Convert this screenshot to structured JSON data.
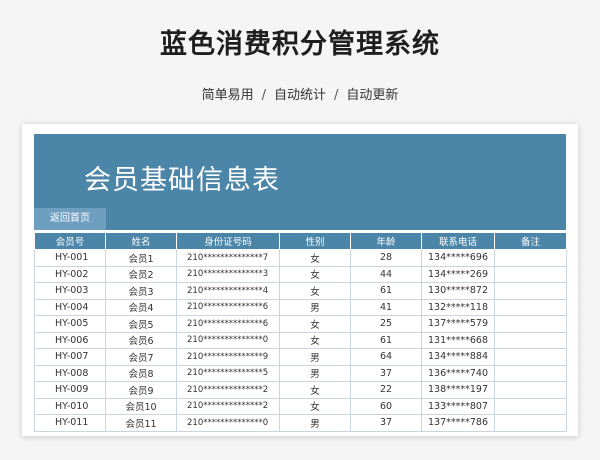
{
  "page": {
    "title": "蓝色消费积分管理系统",
    "subtitle": [
      "简单易用",
      "自动统计",
      "自动更新"
    ],
    "separator": "/"
  },
  "sheet": {
    "banner_title": "会员基础信息表",
    "back_button": "返回首页",
    "colors": {
      "header": "#4b85a8",
      "button": "#6f9fc0"
    },
    "columns": [
      "会员号",
      "姓名",
      "身份证号码",
      "性别",
      "年龄",
      "联系电话",
      "备注"
    ],
    "rows": [
      [
        "HY-001",
        "会员1",
        "210**************7",
        "女",
        "28",
        "134*****696",
        ""
      ],
      [
        "HY-002",
        "会员2",
        "210**************3",
        "女",
        "44",
        "134*****269",
        ""
      ],
      [
        "HY-003",
        "会员3",
        "210**************4",
        "女",
        "61",
        "130*****872",
        ""
      ],
      [
        "HY-004",
        "会员4",
        "210**************6",
        "男",
        "41",
        "132*****118",
        ""
      ],
      [
        "HY-005",
        "会员5",
        "210**************6",
        "女",
        "25",
        "137*****579",
        ""
      ],
      [
        "HY-006",
        "会员6",
        "210**************0",
        "女",
        "61",
        "131*****668",
        ""
      ],
      [
        "HY-007",
        "会员7",
        "210**************9",
        "男",
        "64",
        "134*****884",
        ""
      ],
      [
        "HY-008",
        "会员8",
        "210**************5",
        "男",
        "37",
        "136*****740",
        ""
      ],
      [
        "HY-009",
        "会员9",
        "210**************2",
        "女",
        "22",
        "138*****197",
        ""
      ],
      [
        "HY-010",
        "会员10",
        "210**************2",
        "女",
        "60",
        "133*****807",
        ""
      ],
      [
        "HY-011",
        "会员11",
        "210**************0",
        "男",
        "37",
        "137*****786",
        ""
      ]
    ]
  }
}
